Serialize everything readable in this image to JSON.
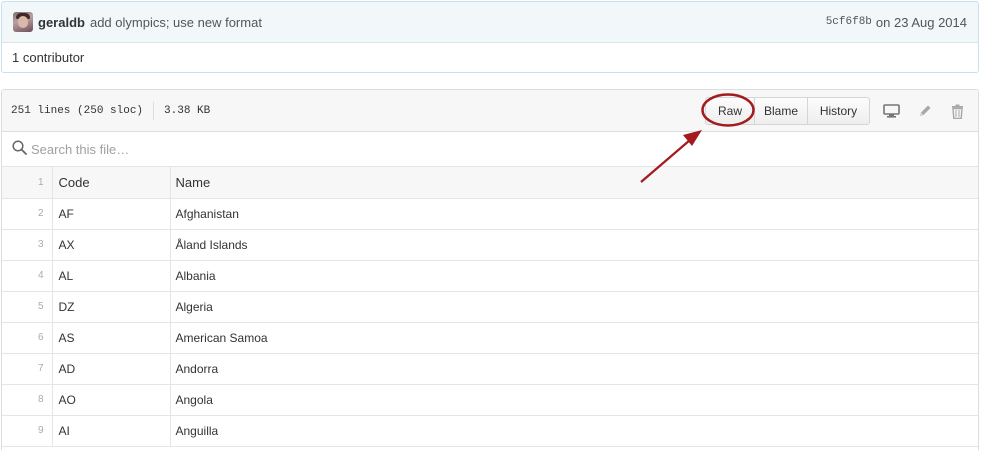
{
  "commit": {
    "author": "geraldb",
    "message": "add olympics; use new format",
    "sha": "5cf6f8b",
    "date_text": "on 23 Aug 2014"
  },
  "contributors_text": "1 contributor",
  "file": {
    "lines_info": "251 lines (250 sloc)",
    "size": "3.38 KB",
    "buttons": {
      "raw": "Raw",
      "blame": "Blame",
      "history": "History"
    }
  },
  "search": {
    "placeholder": "Search this file…"
  },
  "table": {
    "header": {
      "line": "1",
      "code": "Code",
      "name": "Name"
    },
    "rows": [
      {
        "line": "2",
        "code": "AF",
        "name": "Afghanistan"
      },
      {
        "line": "3",
        "code": "AX",
        "name": "Åland Islands"
      },
      {
        "line": "4",
        "code": "AL",
        "name": "Albania"
      },
      {
        "line": "5",
        "code": "DZ",
        "name": "Algeria"
      },
      {
        "line": "6",
        "code": "AS",
        "name": "American Samoa"
      },
      {
        "line": "7",
        "code": "AD",
        "name": "Andorra"
      },
      {
        "line": "8",
        "code": "AO",
        "name": "Angola"
      },
      {
        "line": "9",
        "code": "AI",
        "name": "Anguilla"
      }
    ]
  },
  "icons": {
    "display": "desktop-icon",
    "edit": "pencil-icon",
    "delete": "trashcan-icon",
    "search": "search-icon"
  },
  "colors": {
    "annotation": "#a31b1f",
    "commit_bg": "#f2f8fa",
    "line_number": "#aaaaaa"
  }
}
